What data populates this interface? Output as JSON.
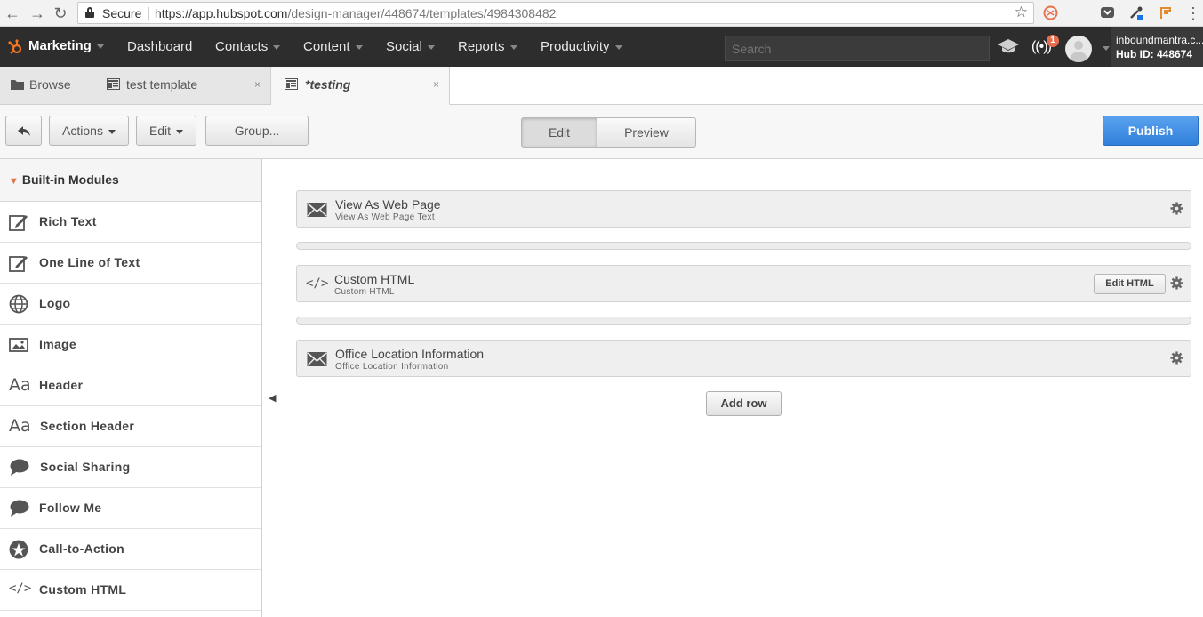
{
  "browser": {
    "secure_label": "Secure",
    "url_host": "https://app.hubspot.com",
    "url_path": "/design-manager/448674/templates/4984308482"
  },
  "hubspot_nav": {
    "brand": "Marketing",
    "items": [
      "Dashboard",
      "Contacts",
      "Content",
      "Social",
      "Reports",
      "Productivity"
    ],
    "search_placeholder": "Search",
    "notification_count": "1",
    "account_name": "inboundmantra.c...",
    "hub_id": "Hub ID: 448674"
  },
  "tabs": [
    {
      "label": "Browse"
    },
    {
      "label": "test template",
      "close": "×"
    },
    {
      "label": "*testing",
      "close": "×"
    }
  ],
  "toolbar": {
    "actions_label": "Actions",
    "edit_label": "Edit",
    "group_label": "Group...",
    "mode_edit": "Edit",
    "mode_preview": "Preview",
    "publish_label": "Publish"
  },
  "sidebar": {
    "header": "Built-in Modules",
    "items": [
      {
        "label": "Rich Text",
        "icon": "edit-icon"
      },
      {
        "label": "One Line of Text",
        "icon": "edit-icon"
      },
      {
        "label": "Logo",
        "icon": "globe-icon"
      },
      {
        "label": "Image",
        "icon": "image-icon"
      },
      {
        "label": "Header",
        "icon": "text-size-icon"
      },
      {
        "label": "Section Header",
        "icon": "text-size-icon"
      },
      {
        "label": "Social Sharing",
        "icon": "speech-bubble-icon"
      },
      {
        "label": "Follow Me",
        "icon": "speech-bubble-icon"
      },
      {
        "label": "Call-to-Action",
        "icon": "star-icon"
      },
      {
        "label": "Custom HTML",
        "icon": "code-icon"
      }
    ]
  },
  "canvas": {
    "modules": [
      {
        "title": "View As Web Page",
        "subtitle": "View As Web Page Text",
        "icon": "envelope-icon"
      },
      {
        "title": "Custom HTML",
        "subtitle": "Custom HTML",
        "icon": "code-icon",
        "action": "Edit HTML"
      },
      {
        "title": "Office Location Information",
        "subtitle": "Office Location Information",
        "icon": "envelope-icon"
      }
    ],
    "add_row_label": "Add row"
  },
  "colors": {
    "nav_bg": "#2d2d2d",
    "publish_blue": "#3a8ee6",
    "accent_orange": "#e2723f"
  }
}
